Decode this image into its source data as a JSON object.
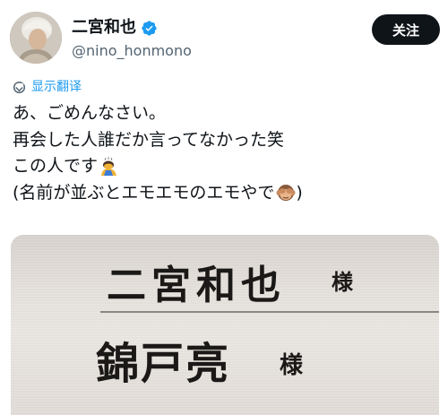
{
  "header": {
    "display_name": "二宮和也",
    "handle": "@nino_honmono",
    "follow_label": "关注"
  },
  "translate": {
    "label": "显示翻译"
  },
  "tweet": {
    "lines": [
      "あ、ごめんなさい。",
      "再会した人誰だか言ってなかった笑",
      "この人です",
      "(名前が並ぶとエモエモのエモやで",
      ")"
    ]
  },
  "media": {
    "name_1": "二宮和也",
    "honorific_1": "様",
    "name_2": "錦戸亮",
    "honorific_2": "様"
  },
  "icons": {
    "verified": "verified-badge-icon",
    "translate": "globe-translate-icon",
    "emoji_1": "person-bowing-emoji",
    "emoji_2": "see-no-evil-monkey-emoji"
  },
  "colors": {
    "accent": "#1d9bf0",
    "text": "#0f1419",
    "secondary": "#536471",
    "follow_bg": "#0f1419"
  }
}
